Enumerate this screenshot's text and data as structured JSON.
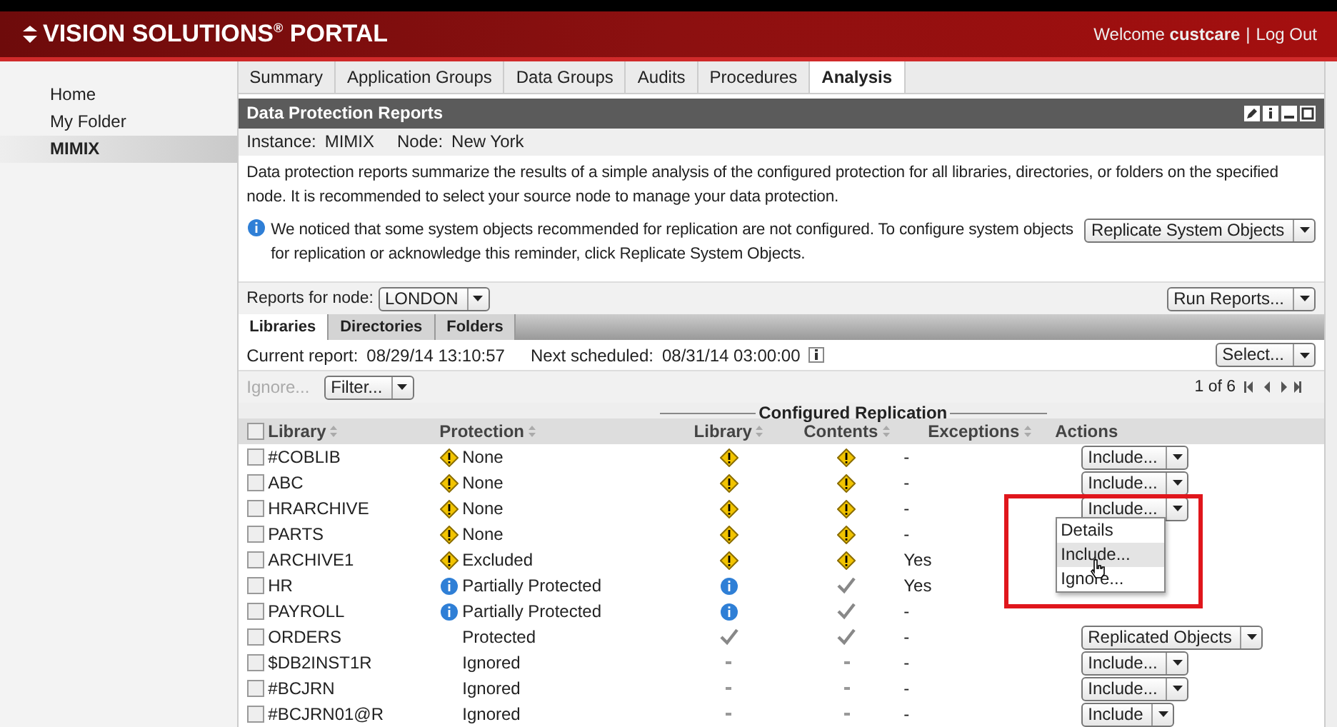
{
  "header": {
    "logo": "VISION SOLUTIONS",
    "logo_mark": "®",
    "logo_tail": "PORTAL",
    "welcome": "Welcome",
    "user": "custcare",
    "separator": "|",
    "logout": "Log Out"
  },
  "sidebar": {
    "items": [
      {
        "label": "Home",
        "selected": false
      },
      {
        "label": "My Folder",
        "selected": false
      },
      {
        "label": "MIMIX",
        "selected": true
      }
    ]
  },
  "tabs": [
    {
      "label": "Summary",
      "selected": false
    },
    {
      "label": "Application Groups",
      "selected": false
    },
    {
      "label": "Data Groups",
      "selected": false
    },
    {
      "label": "Audits",
      "selected": false
    },
    {
      "label": "Procedures",
      "selected": false
    },
    {
      "label": "Analysis",
      "selected": true
    }
  ],
  "panel": {
    "title": "Data Protection Reports",
    "instance_label": "Instance:",
    "instance": "MIMIX",
    "node_label": "Node:",
    "node": "New York",
    "description": "Data protection reports summarize the results of a simple analysis of the configured protection for all libraries, directories, or folders on the specified node. It is recommended to select your source node to manage your data protection.",
    "notice": "We noticed that some system objects recommended for replication are not configured. To configure system objects for replication or acknowledge this reminder, click Replicate System Objects.",
    "notice_button": "Replicate System Objects",
    "reports_label": "Reports for node:",
    "node_select": "LONDON",
    "run_button": "Run Reports..."
  },
  "subtabs": [
    {
      "label": "Libraries",
      "selected": true
    },
    {
      "label": "Directories",
      "selected": false
    },
    {
      "label": "Folders",
      "selected": false
    }
  ],
  "report": {
    "current_label": "Current report:",
    "current": "08/29/14 13:10:57",
    "next_label": "Next scheduled:",
    "next": "08/31/14 03:00:00",
    "select_button": "Select..."
  },
  "toolbar": {
    "ignore": "Ignore...",
    "filter": "Filter...",
    "pages": "1 of 6"
  },
  "table": {
    "group": "Configured Replication",
    "select_all": {
      "checked": false
    },
    "columns": [
      "Library",
      "Protection",
      "Library",
      "Contents",
      "Exceptions",
      "Actions"
    ],
    "rows": [
      {
        "checked": false,
        "name": "#COBLIB",
        "protection": {
          "kind": "warning",
          "text": "None"
        },
        "library": {
          "kind": "warning"
        },
        "contents": {
          "kind": "warning"
        },
        "exceptions": "-",
        "action": "Include..."
      },
      {
        "checked": false,
        "name": "ABC",
        "protection": {
          "kind": "warning",
          "text": "None"
        },
        "library": {
          "kind": "warning"
        },
        "contents": {
          "kind": "warning"
        },
        "exceptions": "-",
        "action": "Include..."
      },
      {
        "checked": false,
        "name": "HRARCHIVE",
        "protection": {
          "kind": "warning",
          "text": "None"
        },
        "library": {
          "kind": "warning"
        },
        "contents": {
          "kind": "warning"
        },
        "exceptions": "-",
        "action": "Include..."
      },
      {
        "checked": false,
        "name": "PARTS",
        "protection": {
          "kind": "warning",
          "text": "None"
        },
        "library": {
          "kind": "warning"
        },
        "contents": {
          "kind": "warning"
        },
        "exceptions": "-"
      },
      {
        "checked": false,
        "name": "ARCHIVE1",
        "protection": {
          "kind": "warning",
          "text": "Excluded"
        },
        "library": {
          "kind": "warning"
        },
        "contents": {
          "kind": "warning"
        },
        "exceptions": "Yes"
      },
      {
        "checked": false,
        "name": "HR",
        "protection": {
          "kind": "info",
          "text": "Partially Protected"
        },
        "library": {
          "kind": "info"
        },
        "contents": {
          "kind": "check"
        },
        "exceptions": "Yes"
      },
      {
        "checked": false,
        "name": "PAYROLL",
        "protection": {
          "kind": "info",
          "text": "Partially Protected"
        },
        "library": {
          "kind": "info"
        },
        "contents": {
          "kind": "check"
        },
        "exceptions": "-"
      },
      {
        "checked": false,
        "name": "ORDERS",
        "protection": {
          "kind": "plain",
          "text": "Protected"
        },
        "library": {
          "kind": "check"
        },
        "contents": {
          "kind": "check"
        },
        "exceptions": "-",
        "action": "Replicated Objects"
      },
      {
        "checked": false,
        "name": "$DB2INST1R",
        "protection": {
          "kind": "plain",
          "text": "Ignored"
        },
        "library": {
          "kind": "dash"
        },
        "contents": {
          "kind": "dash"
        },
        "exceptions": "-",
        "action": "Include..."
      },
      {
        "checked": false,
        "name": "#BCJRN",
        "protection": {
          "kind": "plain",
          "text": "Ignored"
        },
        "library": {
          "kind": "dash"
        },
        "contents": {
          "kind": "dash"
        },
        "exceptions": "-",
        "action": "Include..."
      },
      {
        "checked": false,
        "name": "#BCJRN01@R",
        "protection": {
          "kind": "plain",
          "text": "Ignored"
        },
        "library": {
          "kind": "dash"
        },
        "contents": {
          "kind": "dash"
        },
        "exceptions": "-",
        "action": "Include"
      }
    ]
  },
  "menu": {
    "items": [
      {
        "label": "Details",
        "selected": false
      },
      {
        "label": "Include...",
        "selected": true
      },
      {
        "label": "Ignore...",
        "selected": false
      }
    ]
  }
}
